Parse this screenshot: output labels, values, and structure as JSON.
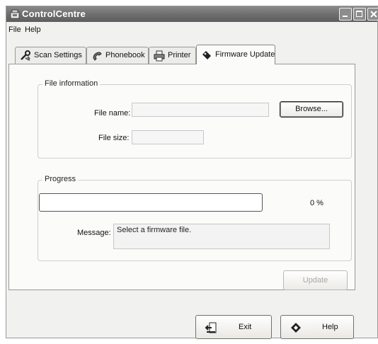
{
  "window": {
    "title": "ControlCentre"
  },
  "menu": {
    "items": [
      "File",
      "Help"
    ]
  },
  "tabs": [
    {
      "label": "Scan Settings",
      "icon": "scan-settings-icon",
      "active": false
    },
    {
      "label": "Phonebook",
      "icon": "phonebook-icon",
      "active": false
    },
    {
      "label": "Printer",
      "icon": "printer-icon",
      "active": false
    },
    {
      "label": "Firmware Update",
      "icon": "firmware-update-icon",
      "active": true
    }
  ],
  "file_info": {
    "legend": "File information",
    "file_name_label": "File name:",
    "file_name_value": "",
    "file_size_label": "File size:",
    "file_size_value": "",
    "browse_label": "Browse..."
  },
  "progress": {
    "legend": "Progress",
    "value": 0,
    "percent_text": "0 %",
    "message_label": "Message:",
    "message_text": "Select a firmware file."
  },
  "update_label": "Update",
  "footer": {
    "exit_label": "Exit",
    "help_label": "Help"
  }
}
